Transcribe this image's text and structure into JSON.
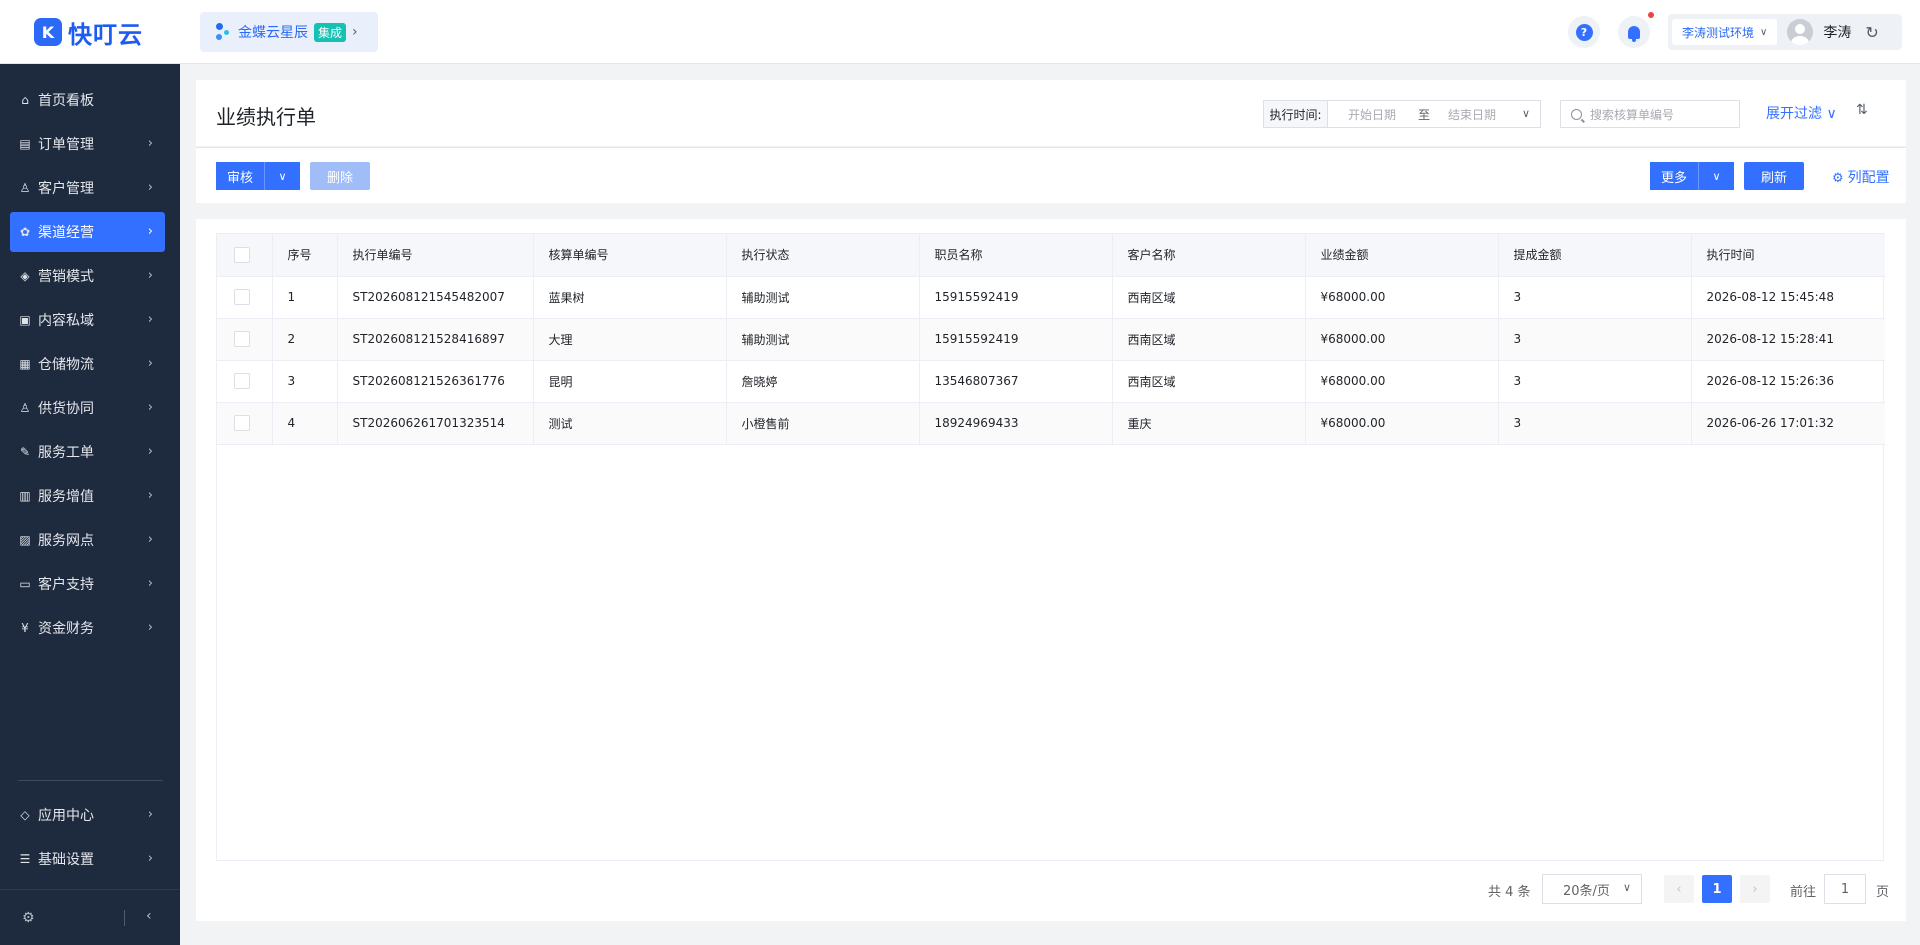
{
  "brand": {
    "logo_glyph": "K",
    "name": "快叮云",
    "color": "#1d5cf0"
  },
  "integration": {
    "name": "金蝶云星辰",
    "badge": "集成",
    "arrow": "›"
  },
  "header_right": {
    "help_glyph": "?",
    "environment": "李涛测试环境",
    "user_name": "李涛",
    "refresh_glyph": "↻"
  },
  "sidebar": {
    "items": [
      {
        "label": "首页看板",
        "icon": "⌂",
        "has_arrow": false
      },
      {
        "label": "订单管理",
        "icon": "▤",
        "has_arrow": true
      },
      {
        "label": "客户管理",
        "icon": "♙",
        "has_arrow": true
      },
      {
        "label": "渠道经营",
        "icon": "✿",
        "has_arrow": true,
        "active": true
      },
      {
        "label": "营销模式",
        "icon": "◈",
        "has_arrow": true
      },
      {
        "label": "内容私域",
        "icon": "▣",
        "has_arrow": true
      },
      {
        "label": "仓储物流",
        "icon": "▦",
        "has_arrow": true
      },
      {
        "label": "供货协同",
        "icon": "♙",
        "has_arrow": true
      },
      {
        "label": "服务工单",
        "icon": "✎",
        "has_arrow": true
      },
      {
        "label": "服务增值",
        "icon": "▥",
        "has_arrow": true
      },
      {
        "label": "服务网点",
        "icon": "▨",
        "has_arrow": true
      },
      {
        "label": "客户支持",
        "icon": "▭",
        "has_arrow": true
      },
      {
        "label": "资金财务",
        "icon": "¥",
        "has_arrow": true
      }
    ],
    "bottom_items": [
      {
        "label": "应用中心",
        "icon": "◇",
        "has_arrow": true
      },
      {
        "label": "基础设置",
        "icon": "☰",
        "has_arrow": true
      }
    ],
    "footer_gear": "⚙",
    "footer_collapse": "‹",
    "arrow_glyph": "›"
  },
  "page": {
    "title": "业绩执行单",
    "filter": {
      "label": "执行时间:",
      "start_placeholder": "开始日期",
      "separator": "至",
      "end_placeholder": "结束日期",
      "search_placeholder": "搜索核算单编号",
      "expand_label": "展开过滤 ∨",
      "sort_glyph": "⇅"
    },
    "toolbar": {
      "audit_label": "审核",
      "delete_label": "删除",
      "more_label": "更多",
      "refresh_label": "刷新",
      "col_config_label": "列配置",
      "caret": "∨"
    }
  },
  "table": {
    "columns": [
      "序号",
      "执行单编号",
      "核算单编号",
      "执行状态",
      "职员名称",
      "客户名称",
      "业绩金额",
      "提成金额",
      "执行时间"
    ],
    "rows": [
      [
        "1",
        "ST202608121545482007",
        "蓝果树",
        "辅助测试",
        "15915592419",
        "西南区域",
        "¥68000.00",
        "3",
        "2026-08-12 15:45:48"
      ],
      [
        "2",
        "ST202608121528416897",
        "大理",
        "辅助测试",
        "15915592419",
        "西南区域",
        "¥68000.00",
        "3",
        "2026-08-12 15:28:41"
      ],
      [
        "3",
        "ST202608121526361776",
        "昆明",
        "詹晓婷",
        "13546807367",
        "西南区域",
        "¥68000.00",
        "3",
        "2026-08-12 15:26:36"
      ],
      [
        "4",
        "ST202606261701323514",
        "测试",
        "小橙售前",
        "18924969433",
        "重庆",
        "¥68000.00",
        "3",
        "2026-06-26 17:01:32"
      ]
    ]
  },
  "pagination": {
    "total": "共 4 条",
    "page_size": "20条/页",
    "prev": "‹",
    "current": "1",
    "next": "›",
    "goto_label": "前往",
    "goto_value": "1",
    "goto_suffix": "页"
  }
}
